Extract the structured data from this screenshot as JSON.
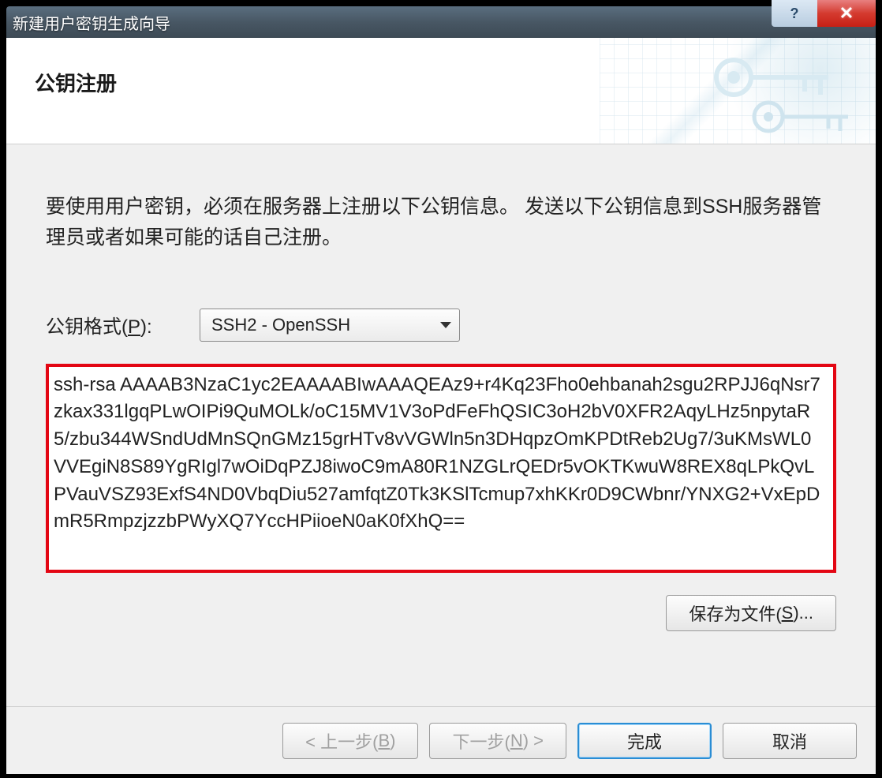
{
  "window": {
    "title": "新建用户密钥生成向导"
  },
  "header": {
    "title": "公钥注册"
  },
  "main": {
    "instruction": "要使用用户密钥，必须在服务器上注册以下公钥信息。 发送以下公钥信息到SSH服务器管理员或者如果可能的话自己注册。",
    "format_label_pre": "公钥格式(",
    "format_label_key": "P",
    "format_label_post": "):",
    "format_value": "SSH2 - OpenSSH",
    "public_key": "ssh-rsa AAAAB3NzaC1yc2EAAAABIwAAAQEAz9+r4Kq23Fho0ehbanah2sgu2RPJJ6qNsr7zkax331lgqPLwOIPi9QuMOLk/oC15MV1V3oPdFeFhQSIC3oH2bV0XFR2AqyLHz5npytaR5/zbu344WSndUdMnSQnGMz15grHTv8vVGWln5n3DHqpzOmKPDtReb2Ug7/3uKMsWL0VVEgiN8S89YgRIgl7wOiDqPZJ8iwoC9mA80R1NZGLrQEDr5vOKTKwuW8REX8qLPkQvLPVauVSZ93ExfS4ND0VbqDiu527amfqtZ0Tk3KSlTcmup7xhKKr0D9CWbnr/YNXG2+VxEpDmR5RmpzjzzbPWyXQ7YccHPiioeN0aK0fXhQ==",
    "save_button_pre": "保存为文件(",
    "save_button_key": "S",
    "save_button_post": ")..."
  },
  "footer": {
    "back_pre": "< 上一步(",
    "back_key": "B",
    "back_post": ")",
    "next_pre": "下一步(",
    "next_key": "N",
    "next_post": ") >",
    "finish": "完成",
    "cancel": "取消"
  }
}
